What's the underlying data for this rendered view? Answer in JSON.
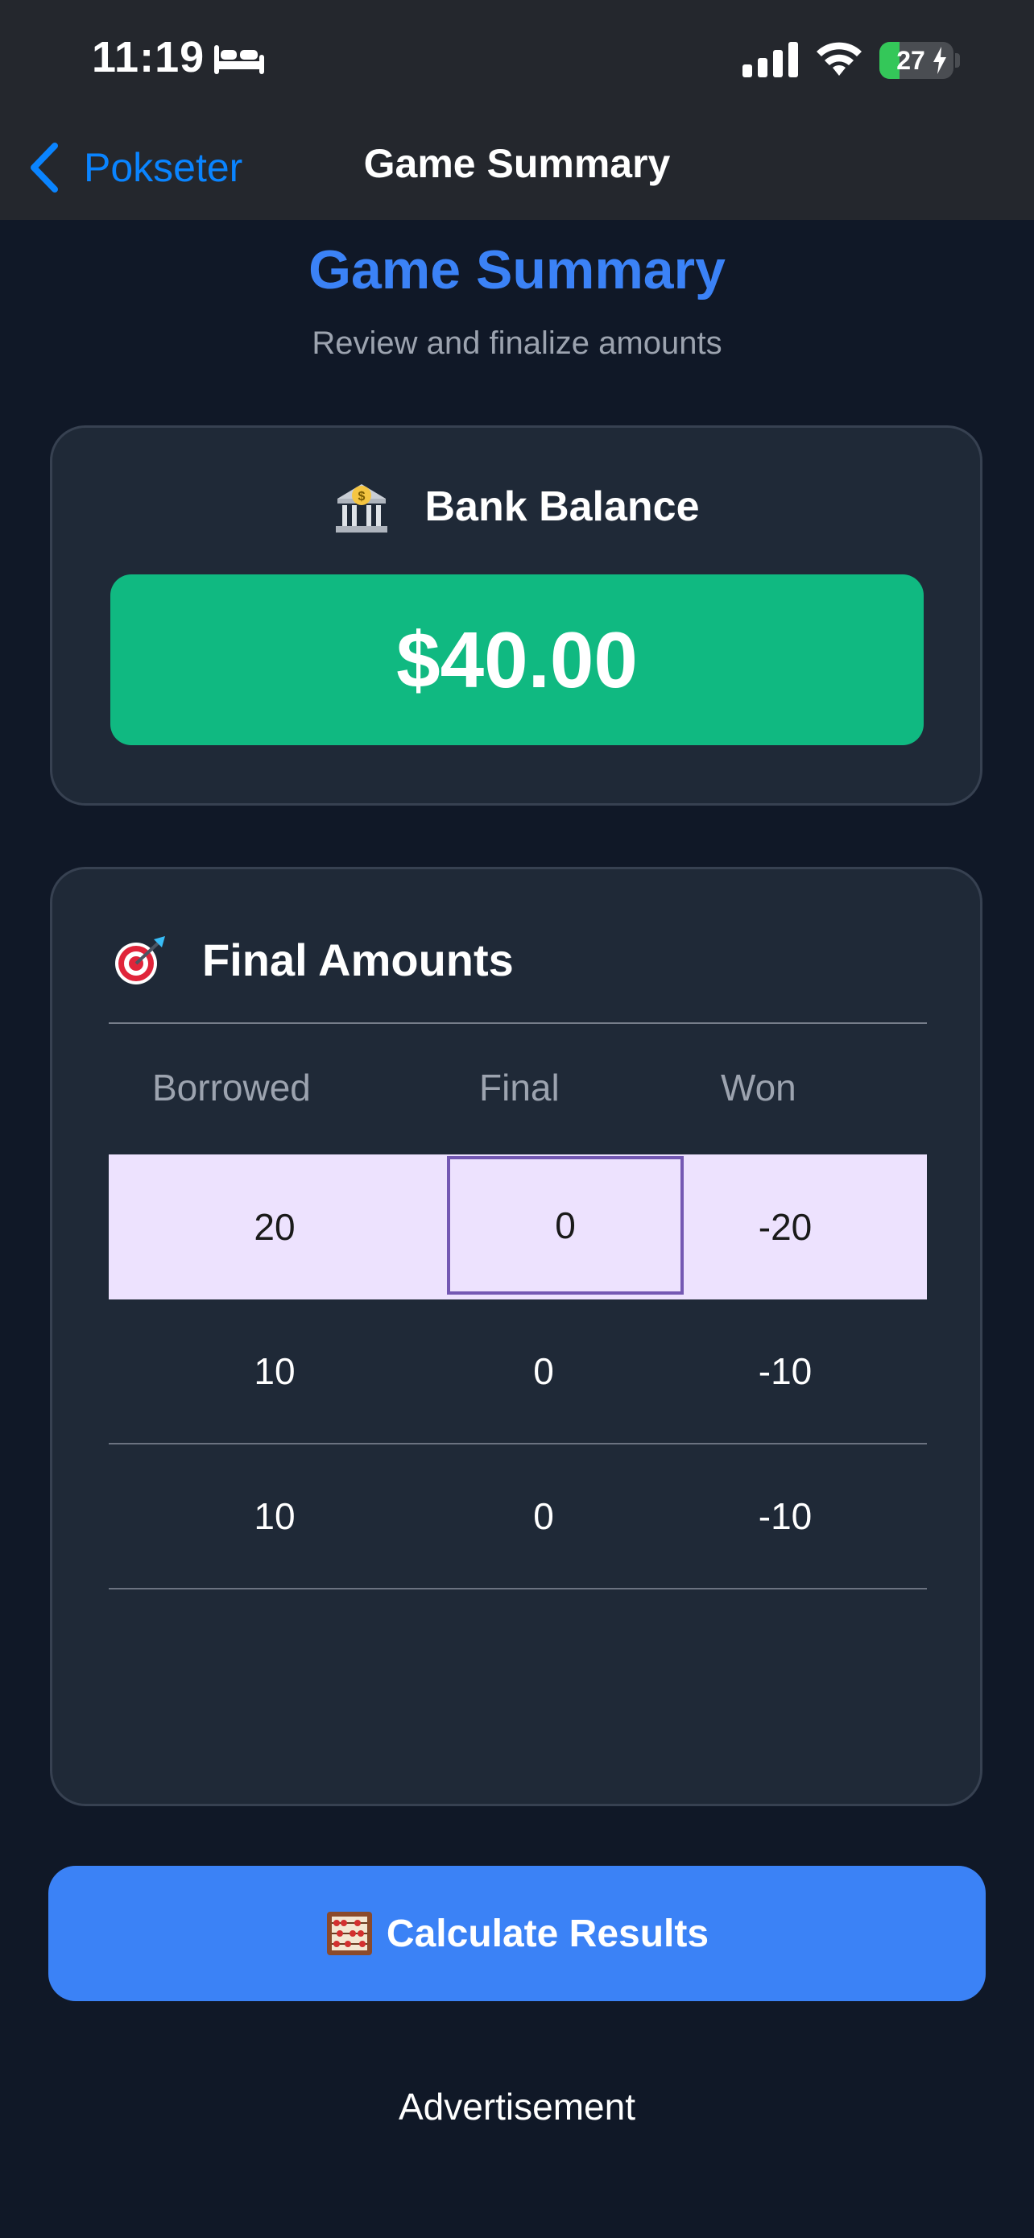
{
  "status_bar": {
    "time": "11:19",
    "battery": "27",
    "battery_level": 0.27
  },
  "nav": {
    "back_label": "Pokseter",
    "title": "Game Summary"
  },
  "header": {
    "title": "Game Summary",
    "subtitle": "Review and finalize amounts"
  },
  "bank": {
    "title": "Bank Balance",
    "icon": "bank-icon",
    "balance": "$40.00"
  },
  "final_amounts": {
    "title": "Final Amounts",
    "icon": "target-icon",
    "columns": [
      "Borrowed",
      "Final",
      "Won"
    ],
    "rows": [
      {
        "borrowed": "20",
        "final": "0",
        "won": "-20"
      },
      {
        "borrowed": "10",
        "final": "0",
        "won": "-10"
      },
      {
        "borrowed": "10",
        "final": "0",
        "won": "-10"
      }
    ]
  },
  "actions": {
    "calculate_label": "Calculate Results",
    "calculate_icon": "abacus-icon"
  },
  "footer": {
    "ad_label": "Advertisement"
  },
  "colors": {
    "accent": "#3b82f6",
    "balance_green": "#10b981",
    "highlight_row": "#ede2fe",
    "ios_link": "#0a84ff"
  }
}
